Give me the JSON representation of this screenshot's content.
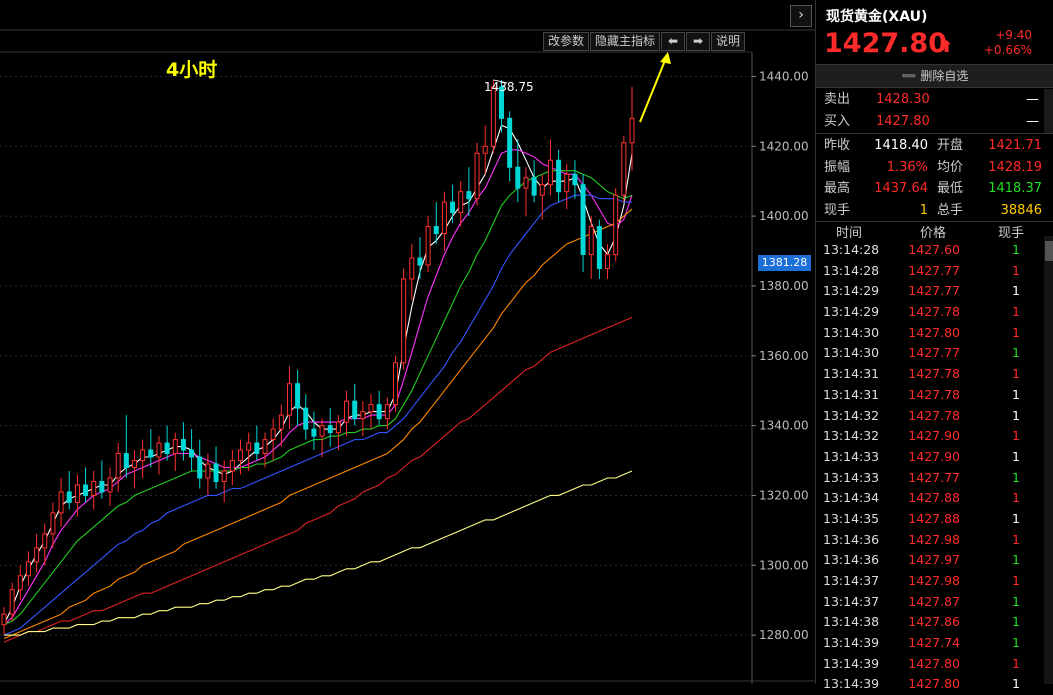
{
  "chart": {
    "timeframe_label": "4小时",
    "high_label": "1438.75",
    "current_price_tag": "1381.28",
    "expand_icon": "›",
    "toolbar": {
      "params": "改参数",
      "hide_indicator": "隐藏主指标",
      "left_arrow": "⬅",
      "right_arrow": "➡",
      "help": "说明"
    }
  },
  "chart_data": {
    "type": "candlestick",
    "ylim": [
      1266,
      1447
    ],
    "y_ticks": [
      "1440.00",
      "1420.00",
      "1400.00",
      "1380.00",
      "1360.00",
      "1340.00",
      "1320.00",
      "1300.00",
      "1280.00"
    ],
    "y_tick_values": [
      1440,
      1420,
      1400,
      1380,
      1360,
      1340,
      1320,
      1300,
      1280
    ],
    "candles": [
      [
        1283,
        1288,
        1280,
        1286
      ],
      [
        1286,
        1295,
        1284,
        1293
      ],
      [
        1293,
        1300,
        1290,
        1297
      ],
      [
        1297,
        1304,
        1294,
        1301
      ],
      [
        1301,
        1309,
        1298,
        1305
      ],
      [
        1305,
        1312,
        1300,
        1309
      ],
      [
        1309,
        1318,
        1305,
        1315
      ],
      [
        1315,
        1325,
        1311,
        1321
      ],
      [
        1321,
        1327,
        1316,
        1318
      ],
      [
        1318,
        1326,
        1314,
        1323
      ],
      [
        1323,
        1328,
        1318,
        1320
      ],
      [
        1320,
        1327,
        1316,
        1324
      ],
      [
        1324,
        1330,
        1319,
        1321
      ],
      [
        1321,
        1328,
        1317,
        1325
      ],
      [
        1325,
        1335,
        1321,
        1332
      ],
      [
        1332,
        1343,
        1325,
        1328
      ],
      [
        1328,
        1333,
        1322,
        1330
      ],
      [
        1330,
        1336,
        1325,
        1333
      ],
      [
        1333,
        1339,
        1328,
        1331
      ],
      [
        1331,
        1337,
        1326,
        1335
      ],
      [
        1335,
        1340,
        1330,
        1332
      ],
      [
        1332,
        1338,
        1327,
        1336
      ],
      [
        1336,
        1341,
        1330,
        1333
      ],
      [
        1333,
        1339,
        1327,
        1331
      ],
      [
        1331,
        1336,
        1322,
        1325
      ],
      [
        1325,
        1332,
        1320,
        1329
      ],
      [
        1329,
        1334,
        1322,
        1324
      ],
      [
        1324,
        1330,
        1318,
        1327
      ],
      [
        1327,
        1333,
        1323,
        1330
      ],
      [
        1330,
        1336,
        1326,
        1333
      ],
      [
        1333,
        1338,
        1327,
        1335
      ],
      [
        1335,
        1340,
        1330,
        1332
      ],
      [
        1332,
        1338,
        1328,
        1336
      ],
      [
        1336,
        1342,
        1330,
        1339
      ],
      [
        1339,
        1346,
        1334,
        1343
      ],
      [
        1343,
        1357,
        1339,
        1352
      ],
      [
        1352,
        1356,
        1340,
        1345
      ],
      [
        1345,
        1349,
        1336,
        1339
      ],
      [
        1339,
        1344,
        1333,
        1337
      ],
      [
        1337,
        1342,
        1331,
        1340
      ],
      [
        1340,
        1345,
        1334,
        1338
      ],
      [
        1338,
        1343,
        1333,
        1341
      ],
      [
        1341,
        1350,
        1337,
        1347
      ],
      [
        1347,
        1352,
        1340,
        1342
      ],
      [
        1342,
        1347,
        1337,
        1344
      ],
      [
        1344,
        1349,
        1339,
        1346
      ],
      [
        1346,
        1350,
        1340,
        1342
      ],
      [
        1342,
        1348,
        1339,
        1346
      ],
      [
        1346,
        1360,
        1344,
        1358
      ],
      [
        1358,
        1385,
        1356,
        1382
      ],
      [
        1382,
        1392,
        1376,
        1388
      ],
      [
        1388,
        1394,
        1382,
        1386
      ],
      [
        1386,
        1400,
        1384,
        1397
      ],
      [
        1397,
        1404,
        1392,
        1395
      ],
      [
        1395,
        1407,
        1390,
        1404
      ],
      [
        1404,
        1409,
        1398,
        1401
      ],
      [
        1401,
        1410,
        1397,
        1407
      ],
      [
        1407,
        1414,
        1400,
        1405
      ],
      [
        1405,
        1421,
        1403,
        1418
      ],
      [
        1418,
        1426,
        1412,
        1420
      ],
      [
        1420,
        1439,
        1418,
        1437
      ],
      [
        1437,
        1439,
        1424,
        1428
      ],
      [
        1428,
        1430,
        1410,
        1414
      ],
      [
        1414,
        1422,
        1404,
        1408
      ],
      [
        1408,
        1414,
        1400,
        1411
      ],
      [
        1411,
        1416,
        1404,
        1406
      ],
      [
        1406,
        1412,
        1399,
        1409
      ],
      [
        1409,
        1422,
        1406,
        1416
      ],
      [
        1416,
        1419,
        1404,
        1407
      ],
      [
        1407,
        1415,
        1402,
        1412
      ],
      [
        1412,
        1416,
        1405,
        1409
      ],
      [
        1409,
        1412,
        1384,
        1389
      ],
      [
        1389,
        1400,
        1382,
        1397
      ],
      [
        1397,
        1399,
        1382,
        1385
      ],
      [
        1385,
        1392,
        1382,
        1389
      ],
      [
        1389,
        1408,
        1387,
        1406
      ],
      [
        1406,
        1423,
        1404,
        1421
      ],
      [
        1421,
        1437,
        1413,
        1428
      ]
    ],
    "ma_series": [
      {
        "color": "#ffffff",
        "values": [
          1283,
          1288,
          1294,
          1299,
          1303,
          1307,
          1312,
          1317,
          1319,
          1320,
          1321,
          1322,
          1323,
          1323,
          1326,
          1328,
          1329,
          1331,
          1331,
          1332,
          1333,
          1334,
          1334,
          1333,
          1330,
          1328,
          1327,
          1326,
          1327,
          1329,
          1331,
          1333,
          1334,
          1336,
          1339,
          1344,
          1346,
          1344,
          1341,
          1339,
          1339,
          1339,
          1342,
          1343,
          1343,
          1344,
          1344,
          1344,
          1349,
          1362,
          1374,
          1384,
          1391,
          1393,
          1396,
          1400,
          1403,
          1404,
          1408,
          1412,
          1419,
          1426,
          1425,
          1421,
          1416,
          1411,
          1408,
          1410,
          1410,
          1410,
          1411,
          1405,
          1398,
          1392,
          1389,
          1394,
          1403,
          1418
        ]
      },
      {
        "color": "#ff33ff",
        "values": [
          1283,
          1285,
          1289,
          1293,
          1297,
          1301,
          1306,
          1310,
          1313,
          1316,
          1318,
          1320,
          1321,
          1322,
          1324,
          1326,
          1327,
          1328,
          1329,
          1330,
          1331,
          1332,
          1332,
          1332,
          1331,
          1330,
          1329,
          1328,
          1328,
          1328,
          1329,
          1330,
          1331,
          1333,
          1335,
          1338,
          1340,
          1341,
          1341,
          1341,
          1341,
          1341,
          1342,
          1342,
          1342,
          1343,
          1343,
          1343,
          1346,
          1353,
          1361,
          1369,
          1377,
          1383,
          1389,
          1394,
          1398,
          1401,
          1405,
          1408,
          1413,
          1418,
          1419,
          1419,
          1418,
          1417,
          1415,
          1414,
          1413,
          1412,
          1412,
          1409,
          1406,
          1402,
          1398,
          1397,
          1399,
          1406
        ]
      },
      {
        "color": "#22cc22",
        "values": [
          1283,
          1284,
          1286,
          1289,
          1292,
          1295,
          1298,
          1301,
          1304,
          1307,
          1309,
          1311,
          1313,
          1315,
          1317,
          1318,
          1320,
          1321,
          1322,
          1323,
          1324,
          1325,
          1326,
          1327,
          1327,
          1327,
          1327,
          1327,
          1327,
          1328,
          1328,
          1329,
          1329,
          1330,
          1331,
          1333,
          1334,
          1335,
          1336,
          1336,
          1337,
          1337,
          1338,
          1338,
          1339,
          1339,
          1340,
          1340,
          1342,
          1346,
          1350,
          1355,
          1360,
          1365,
          1370,
          1375,
          1380,
          1384,
          1389,
          1393,
          1398,
          1403,
          1406,
          1408,
          1410,
          1411,
          1412,
          1413,
          1413,
          1413,
          1413,
          1412,
          1411,
          1409,
          1407,
          1406,
          1405,
          1406
        ]
      },
      {
        "color": "#3355ff",
        "values": [
          1280,
          1281,
          1282,
          1284,
          1286,
          1288,
          1290,
          1292,
          1294,
          1296,
          1298,
          1300,
          1302,
          1304,
          1306,
          1307,
          1309,
          1310,
          1312,
          1313,
          1315,
          1316,
          1317,
          1318,
          1319,
          1320,
          1320,
          1321,
          1322,
          1322,
          1323,
          1324,
          1325,
          1326,
          1327,
          1328,
          1329,
          1330,
          1331,
          1332,
          1333,
          1334,
          1335,
          1336,
          1336,
          1337,
          1338,
          1338,
          1340,
          1342,
          1345,
          1348,
          1351,
          1354,
          1357,
          1361,
          1364,
          1368,
          1372,
          1376,
          1380,
          1385,
          1389,
          1392,
          1395,
          1398,
          1401,
          1403,
          1404,
          1405,
          1406,
          1406,
          1406,
          1405,
          1405,
          1405,
          1404,
          1404
        ]
      },
      {
        "color": "#ff8800",
        "values": [
          1279,
          1280,
          1281,
          1282,
          1283,
          1284,
          1285,
          1286,
          1288,
          1289,
          1290,
          1292,
          1293,
          1294,
          1296,
          1297,
          1298,
          1300,
          1301,
          1302,
          1303,
          1304,
          1306,
          1307,
          1308,
          1309,
          1310,
          1311,
          1312,
          1313,
          1314,
          1315,
          1316,
          1317,
          1318,
          1320,
          1321,
          1322,
          1323,
          1324,
          1325,
          1326,
          1327,
          1328,
          1329,
          1330,
          1331,
          1332,
          1334,
          1336,
          1339,
          1341,
          1344,
          1347,
          1350,
          1353,
          1356,
          1359,
          1362,
          1365,
          1368,
          1372,
          1375,
          1378,
          1381,
          1383,
          1386,
          1388,
          1390,
          1392,
          1393,
          1394,
          1395,
          1396,
          1397,
          1398,
          1400,
          1402
        ]
      },
      {
        "color": "#dd2222",
        "values": [
          1278,
          1279,
          1280,
          1281,
          1281,
          1282,
          1283,
          1284,
          1284,
          1285,
          1286,
          1287,
          1287,
          1288,
          1289,
          1290,
          1291,
          1292,
          1292,
          1293,
          1294,
          1295,
          1296,
          1297,
          1298,
          1299,
          1300,
          1301,
          1302,
          1303,
          1304,
          1305,
          1306,
          1307,
          1308,
          1309,
          1310,
          1312,
          1313,
          1314,
          1315,
          1317,
          1318,
          1319,
          1321,
          1322,
          1323,
          1325,
          1326,
          1328,
          1330,
          1331,
          1333,
          1335,
          1337,
          1339,
          1341,
          1342,
          1344,
          1346,
          1348,
          1350,
          1352,
          1354,
          1356,
          1357,
          1359,
          1361,
          1362,
          1363,
          1364,
          1365,
          1366,
          1367,
          1368,
          1369,
          1370,
          1371
        ]
      },
      {
        "color": "#ffff88",
        "values": [
          1280,
          1280,
          1280,
          1281,
          1281,
          1281,
          1282,
          1282,
          1282,
          1283,
          1283,
          1283,
          1284,
          1284,
          1285,
          1285,
          1285,
          1286,
          1286,
          1287,
          1287,
          1288,
          1288,
          1288,
          1289,
          1289,
          1290,
          1290,
          1291,
          1291,
          1292,
          1292,
          1293,
          1293,
          1294,
          1294,
          1295,
          1296,
          1296,
          1297,
          1297,
          1298,
          1299,
          1299,
          1300,
          1301,
          1301,
          1302,
          1303,
          1304,
          1305,
          1305,
          1306,
          1307,
          1308,
          1309,
          1310,
          1311,
          1312,
          1313,
          1313,
          1314,
          1315,
          1316,
          1317,
          1318,
          1319,
          1320,
          1320,
          1321,
          1322,
          1323,
          1323,
          1324,
          1325,
          1325,
          1326,
          1327
        ]
      }
    ]
  },
  "panel": {
    "title": "现货黄金(XAU)",
    "price": "1427.80",
    "price_arrow": "⬆",
    "change": "+9.40",
    "change_pct": "+0.66%",
    "remove_watch": "➖ 删除自选",
    "sell_label": "卖出",
    "sell_price": "1428.30",
    "sell_vol": "—",
    "buy_label": "买入",
    "buy_price": "1427.80",
    "buy_vol": "—",
    "stats": [
      {
        "k1": "昨收",
        "v1": "1418.40",
        "c1": "white",
        "k2": "开盘",
        "v2": "1421.71",
        "c2": "red"
      },
      {
        "k1": "振幅",
        "v1": "1.36%",
        "c1": "red",
        "k2": "均价",
        "v2": "1428.19",
        "c2": "red"
      },
      {
        "k1": "最高",
        "v1": "1437.64",
        "c1": "red",
        "k2": "最低",
        "v2": "1418.37",
        "c2": "green"
      },
      {
        "k1": "现手",
        "v1": "1",
        "c1": "yellow",
        "k2": "总手",
        "v2": "38846",
        "c2": "yellow"
      }
    ],
    "tick_headers": {
      "time": "时间",
      "price": "价格",
      "vol": "现手"
    },
    "ticks": [
      {
        "time": "13:14:28",
        "price": "1427.60",
        "vol": "1",
        "vc": "green"
      },
      {
        "time": "13:14:28",
        "price": "1427.77",
        "vol": "1",
        "vc": "red"
      },
      {
        "time": "13:14:29",
        "price": "1427.77",
        "vol": "1",
        "vc": "white"
      },
      {
        "time": "13:14:29",
        "price": "1427.78",
        "vol": "1",
        "vc": "red"
      },
      {
        "time": "13:14:30",
        "price": "1427.80",
        "vol": "1",
        "vc": "red"
      },
      {
        "time": "13:14:30",
        "price": "1427.77",
        "vol": "1",
        "vc": "green"
      },
      {
        "time": "13:14:31",
        "price": "1427.78",
        "vol": "1",
        "vc": "red"
      },
      {
        "time": "13:14:31",
        "price": "1427.78",
        "vol": "1",
        "vc": "white"
      },
      {
        "time": "13:14:32",
        "price": "1427.78",
        "vol": "1",
        "vc": "white"
      },
      {
        "time": "13:14:32",
        "price": "1427.90",
        "vol": "1",
        "vc": "red"
      },
      {
        "time": "13:14:33",
        "price": "1427.90",
        "vol": "1",
        "vc": "white"
      },
      {
        "time": "13:14:33",
        "price": "1427.77",
        "vol": "1",
        "vc": "green"
      },
      {
        "time": "13:14:34",
        "price": "1427.88",
        "vol": "1",
        "vc": "red"
      },
      {
        "time": "13:14:35",
        "price": "1427.88",
        "vol": "1",
        "vc": "white"
      },
      {
        "time": "13:14:36",
        "price": "1427.98",
        "vol": "1",
        "vc": "red"
      },
      {
        "time": "13:14:36",
        "price": "1427.97",
        "vol": "1",
        "vc": "green"
      },
      {
        "time": "13:14:37",
        "price": "1427.98",
        "vol": "1",
        "vc": "red"
      },
      {
        "time": "13:14:37",
        "price": "1427.87",
        "vol": "1",
        "vc": "green"
      },
      {
        "time": "13:14:38",
        "price": "1427.86",
        "vol": "1",
        "vc": "green"
      },
      {
        "time": "13:14:39",
        "price": "1427.74",
        "vol": "1",
        "vc": "green"
      },
      {
        "time": "13:14:39",
        "price": "1427.80",
        "vol": "1",
        "vc": "red"
      },
      {
        "time": "13:14:39",
        "price": "1427.80",
        "vol": "1",
        "vc": "white"
      }
    ]
  }
}
